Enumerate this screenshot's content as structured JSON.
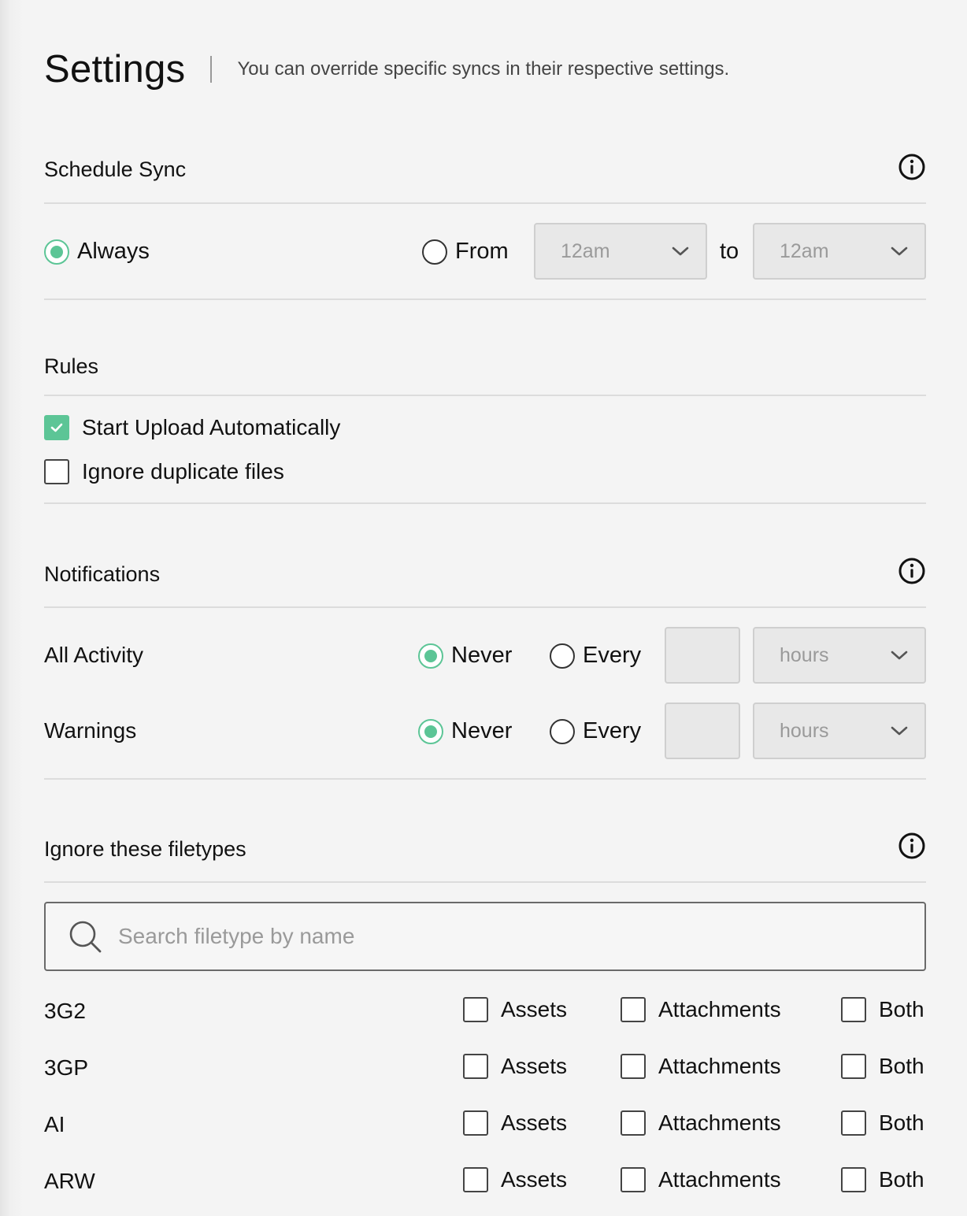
{
  "header": {
    "title": "Settings",
    "subtitle": "You can override specific syncs in their respective settings."
  },
  "schedule": {
    "title": "Schedule Sync",
    "info_icon": "info-circle-icon",
    "always_label": "Always",
    "from_label": "From",
    "to_label": "to",
    "from_value": "12am",
    "to_value": "12am",
    "selected": "always"
  },
  "rules": {
    "title": "Rules",
    "items": [
      {
        "label": "Start Upload Automatically",
        "checked": true
      },
      {
        "label": "Ignore duplicate files",
        "checked": false
      }
    ]
  },
  "notifications": {
    "title": "Notifications",
    "info_icon": "info-circle-icon",
    "rows": [
      {
        "label": "All Activity",
        "never_label": "Never",
        "every_label": "Every",
        "unit": "hours",
        "selected": "never",
        "count": ""
      },
      {
        "label": "Warnings",
        "never_label": "Never",
        "every_label": "Every",
        "unit": "hours",
        "selected": "never",
        "count": ""
      }
    ]
  },
  "filetypes": {
    "title": "Ignore these filetypes",
    "info_icon": "info-circle-icon",
    "search_placeholder": "Search filetype by name",
    "search_value": "",
    "option_labels": {
      "assets": "Assets",
      "attachments": "Attachments",
      "both": "Both"
    },
    "rows": [
      {
        "name": "3G2",
        "assets": false,
        "attachments": false,
        "both": false
      },
      {
        "name": "3GP",
        "assets": false,
        "attachments": false,
        "both": false
      },
      {
        "name": "AI",
        "assets": false,
        "attachments": false,
        "both": false
      },
      {
        "name": "ARW",
        "assets": false,
        "attachments": false,
        "both": false
      }
    ]
  },
  "colors": {
    "accent": "#5cc596",
    "background": "#f4f4f4",
    "divider": "#dcdcdc",
    "disabled_field": "#e8e8e8"
  }
}
